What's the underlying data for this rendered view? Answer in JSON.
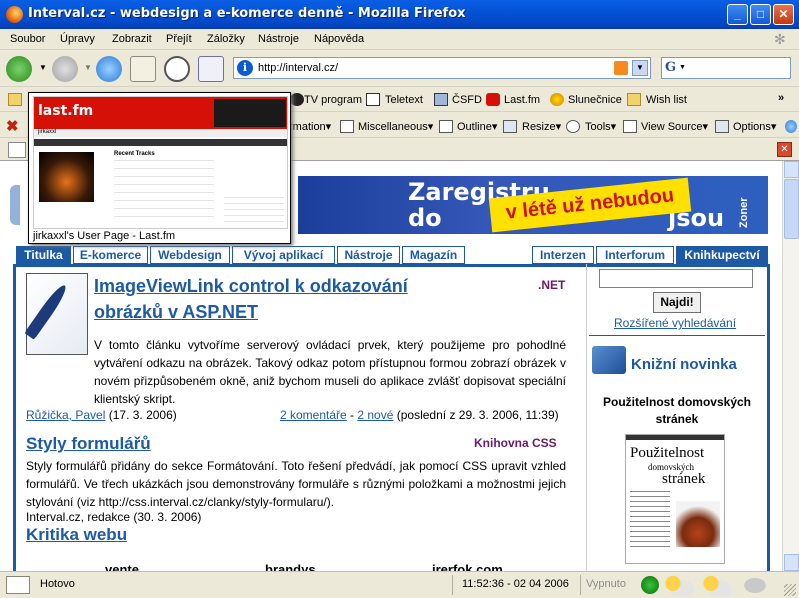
{
  "window": {
    "title": "Interval.cz - webdesign a e-komerce denně - Mozilla Firefox"
  },
  "menu": [
    "Soubor",
    "Úpravy",
    "Zobrazit",
    "Přejít",
    "Záložky",
    "Nástroje",
    "Nápověda"
  ],
  "url": "http://interval.cz/",
  "search_engine_icon": "google-icon",
  "bookmarks": [
    "TV program",
    "Teletext",
    "ČSFD",
    "Last.fm",
    "Slunečnice",
    "Wish list"
  ],
  "webdev_toolbar": [
    "rmation▾",
    "Miscellaneous▾",
    "Outline▾",
    "Resize▾",
    "Tools▾",
    "View Source▾",
    "Options▾"
  ],
  "tooltip": {
    "caption": "jirkaxxl's User Page - Last.fm",
    "logo": "last.fm",
    "username": "jirkaxxl",
    "section": "Recent Tracks"
  },
  "banner": {
    "line1": "Zaregistru",
    "line2": "do",
    "line2b": "jsou",
    "ribbon": "v létě už nebudou",
    "brand": "Zoner"
  },
  "tabs": [
    "Titulka",
    "E-komerce",
    "Webdesign",
    "Vývoj aplikací",
    "Nástroje",
    "Magazín"
  ],
  "tabs_right": [
    "Interzen",
    "Interforum",
    "Knihkupectví"
  ],
  "articles": [
    {
      "title_line1": "ImageViewLink control k odkazování",
      "title_line2": "obrázků v ASP.NET",
      "category": ".NET",
      "text": "V tomto článku vytvoříme serverový ovládací prvek, který použijeme pro pohodlné vytváření odkazu na obrázek. Takový odkaz potom přístupnou formou zobrazí obrázek v novém přizpůsobeném okně, aniž bychom museli do aplikace zvlášť dopisovat speciální klientský skript.",
      "author": "Růžička, Pavel",
      "date": "(17. 3. 2006)",
      "comments": "2 komentáře",
      "new": "2 nové",
      "last": "(poslední z 29. 3. 2006, 11:39)",
      "sep": " - "
    },
    {
      "title": "Styly formulářů",
      "category": "Knihovna CSS",
      "text": "Styly formulářů přidány do sekce Formátování. Toto řešení předvádí, jak pomocí CSS upravit vzhled formulářů. Ve třech ukázkách jsou demonstrovány formuláře s různými položkami a možnostmi jejich stylování (viz http://css.interval.cz/clanky/styly-formularu/).",
      "author_line": "Interval.cz, redakce (30. 3. 2006)"
    },
    {
      "title": "Kritika webu"
    }
  ],
  "bottom_cut": [
    "vente",
    "brandys",
    "irerfok.com"
  ],
  "sidebar": {
    "search_button": "Najdi!",
    "advanced": "Rozšířené vyhledávání",
    "book_heading": "Knižní novinka",
    "book_title": "Použitelnost domovských stránek",
    "cover_title_1": "Použitelnost",
    "cover_title_2": "domovských",
    "cover_title_3": "stránek"
  },
  "status": {
    "text": "Hotovo",
    "clock": "11:52:36 - 02 04 2006",
    "off": "Vypnuto"
  },
  "colors": {
    "accent": "#1d5aa6",
    "category": "#6a1b6a",
    "ribbon": "#ffe000"
  }
}
